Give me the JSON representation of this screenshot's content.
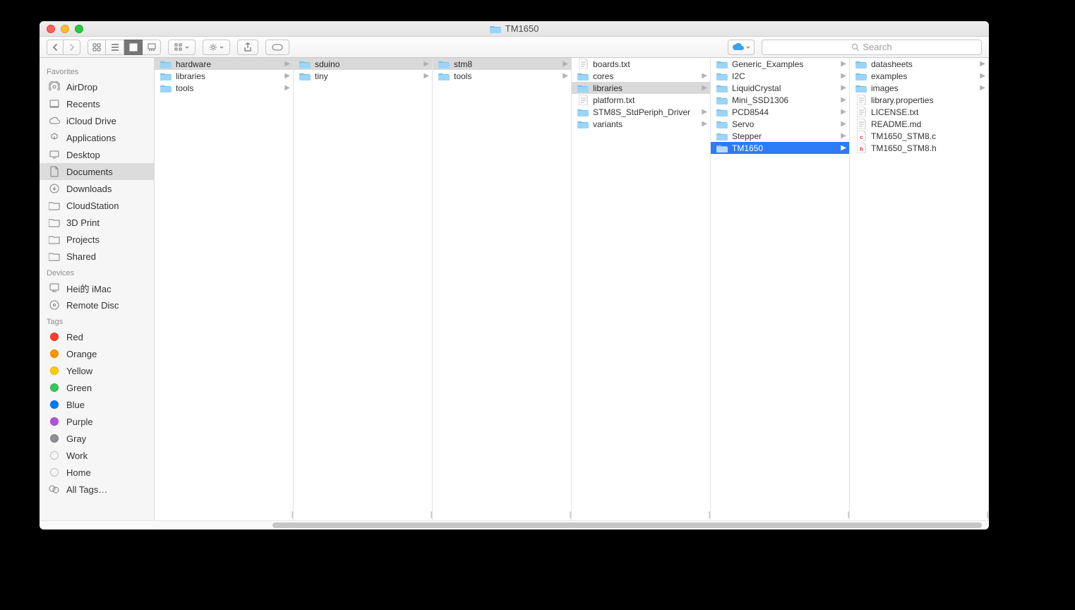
{
  "window": {
    "title": "TM1650"
  },
  "search": {
    "placeholder": "Search"
  },
  "sidebar": {
    "sections": [
      {
        "header": "Favorites",
        "items": [
          {
            "label": "AirDrop",
            "icon": "airdrop"
          },
          {
            "label": "Recents",
            "icon": "recents"
          },
          {
            "label": "iCloud Drive",
            "icon": "icloud"
          },
          {
            "label": "Applications",
            "icon": "apps"
          },
          {
            "label": "Desktop",
            "icon": "desktop"
          },
          {
            "label": "Documents",
            "icon": "documents",
            "selected": true
          },
          {
            "label": "Downloads",
            "icon": "downloads"
          },
          {
            "label": "CloudStation",
            "icon": "folder"
          },
          {
            "label": "3D Print",
            "icon": "folder"
          },
          {
            "label": "Projects",
            "icon": "folder"
          },
          {
            "label": "Shared",
            "icon": "folder"
          }
        ]
      },
      {
        "header": "Devices",
        "items": [
          {
            "label": "Hei的 iMac",
            "icon": "imac"
          },
          {
            "label": "Remote Disc",
            "icon": "disc"
          }
        ]
      },
      {
        "header": "Tags",
        "items": [
          {
            "label": "Red",
            "icon": "tag",
            "color": "#ff3b30"
          },
          {
            "label": "Orange",
            "icon": "tag",
            "color": "#ff9500"
          },
          {
            "label": "Yellow",
            "icon": "tag",
            "color": "#ffcc00"
          },
          {
            "label": "Green",
            "icon": "tag",
            "color": "#34c759"
          },
          {
            "label": "Blue",
            "icon": "tag",
            "color": "#007aff"
          },
          {
            "label": "Purple",
            "icon": "tag",
            "color": "#af52de"
          },
          {
            "label": "Gray",
            "icon": "tag",
            "color": "#8e8e93"
          },
          {
            "label": "Work",
            "icon": "tag",
            "color": "transparent"
          },
          {
            "label": "Home",
            "icon": "tag",
            "color": "transparent"
          },
          {
            "label": "All Tags…",
            "icon": "alltags"
          }
        ]
      }
    ]
  },
  "columns": [
    {
      "items": [
        {
          "name": "hardware",
          "type": "folder",
          "hasChildren": true,
          "selected": true
        },
        {
          "name": "libraries",
          "type": "folder",
          "hasChildren": true
        },
        {
          "name": "tools",
          "type": "folder",
          "hasChildren": true
        }
      ]
    },
    {
      "items": [
        {
          "name": "sduino",
          "type": "folder",
          "hasChildren": true,
          "selected": true
        },
        {
          "name": "tiny",
          "type": "folder",
          "hasChildren": true
        }
      ]
    },
    {
      "items": [
        {
          "name": "stm8",
          "type": "folder",
          "hasChildren": true,
          "selected": true
        },
        {
          "name": "tools",
          "type": "folder",
          "hasChildren": true
        }
      ]
    },
    {
      "items": [
        {
          "name": "boards.txt",
          "type": "file-txt"
        },
        {
          "name": "cores",
          "type": "folder",
          "hasChildren": true
        },
        {
          "name": "libraries",
          "type": "folder",
          "hasChildren": true,
          "selected": true
        },
        {
          "name": "platform.txt",
          "type": "file-txt"
        },
        {
          "name": "STM8S_StdPeriph_Driver",
          "type": "folder",
          "hasChildren": true
        },
        {
          "name": "variants",
          "type": "folder",
          "hasChildren": true
        }
      ]
    },
    {
      "items": [
        {
          "name": "Generic_Examples",
          "type": "folder",
          "hasChildren": true
        },
        {
          "name": "I2C",
          "type": "folder",
          "hasChildren": true
        },
        {
          "name": "LiquidCrystal",
          "type": "folder",
          "hasChildren": true
        },
        {
          "name": "Mini_SSD1306",
          "type": "folder",
          "hasChildren": true
        },
        {
          "name": "PCD8544",
          "type": "folder",
          "hasChildren": true
        },
        {
          "name": "Servo",
          "type": "folder",
          "hasChildren": true
        },
        {
          "name": "Stepper",
          "type": "folder",
          "hasChildren": true
        },
        {
          "name": "TM1650",
          "type": "folder",
          "hasChildren": true,
          "highlighted": true
        }
      ]
    },
    {
      "items": [
        {
          "name": "datasheets",
          "type": "folder",
          "hasChildren": true
        },
        {
          "name": "examples",
          "type": "folder",
          "hasChildren": true
        },
        {
          "name": "images",
          "type": "folder",
          "hasChildren": true
        },
        {
          "name": "library.properties",
          "type": "file-txt"
        },
        {
          "name": "LICENSE.txt",
          "type": "file-txt"
        },
        {
          "name": "README.md",
          "type": "file-txt"
        },
        {
          "name": "TM1650_STM8.c",
          "type": "file-c"
        },
        {
          "name": "TM1650_STM8.h",
          "type": "file-h"
        }
      ]
    }
  ]
}
